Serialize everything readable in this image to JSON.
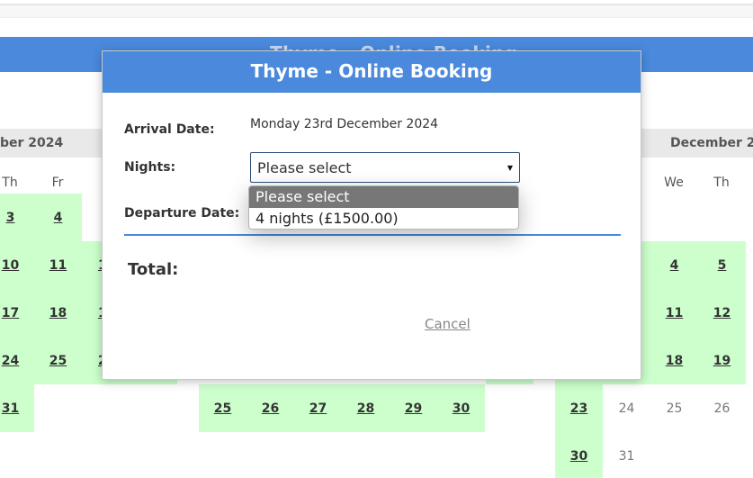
{
  "background": {
    "banner_ghost_title": "Thyme - Online Booking",
    "left_month_fragment": "ber 2024",
    "right_month_fragment": "December 2024",
    "left_weekdays": [
      "Th",
      "Fr",
      "S"
    ],
    "right_weekdays": [
      "We",
      "Th"
    ],
    "left_col_th": [
      "3",
      "10",
      "17",
      "24",
      "31"
    ],
    "left_col_fr": [
      "4",
      "11",
      "18",
      "25"
    ],
    "left_col_sa": [
      "1",
      "1",
      "2"
    ],
    "bottom_row_dates": [
      "25",
      "26",
      "27",
      "28",
      "29",
      "30"
    ],
    "right_col1_avail": [
      "23"
    ],
    "right_col1_plain": [
      "30"
    ],
    "right_col2_plain": [
      "24",
      "31"
    ],
    "right_col3_avail": [
      "4",
      "11",
      "18"
    ],
    "right_col3_plain": [
      "25"
    ],
    "right_col4_avail": [
      "5",
      "12",
      "19"
    ],
    "right_col4_plain": [
      "26"
    ]
  },
  "modal": {
    "title": "Thyme - Online Booking",
    "arrival_label": "Arrival Date:",
    "arrival_value": "Monday 23rd December 2024",
    "nights_label": "Nights:",
    "nights_selected": "Please select",
    "departure_label": "Departure Date:",
    "total_label": "Total:",
    "cancel_label": "Cancel"
  },
  "dropdown": {
    "options": [
      "Please select",
      "4 nights (£1500.00)"
    ],
    "highlighted_index": 0
  },
  "colors": {
    "header_blue": "#4a89dc",
    "available_green": "#ccffcc",
    "highlight_grey": "#777777"
  }
}
